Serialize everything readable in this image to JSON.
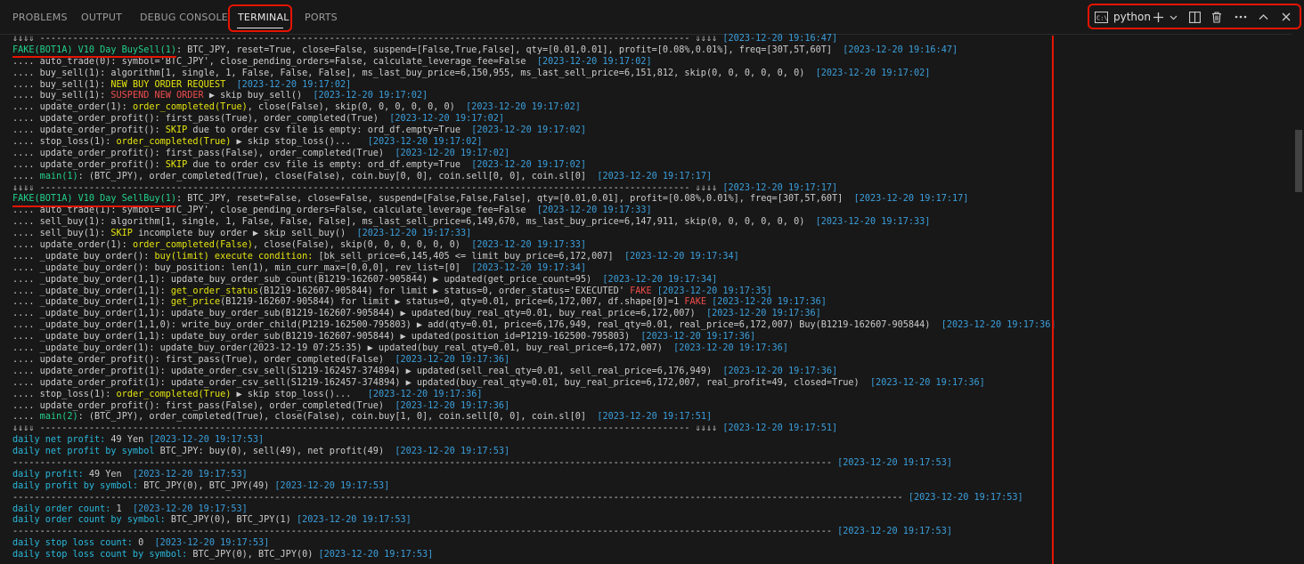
{
  "tabs": [
    {
      "label": "PROBLEMS"
    },
    {
      "label": "OUTPUT"
    },
    {
      "label": "DEBUG CONSOLE"
    },
    {
      "label": "TERMINAL"
    },
    {
      "label": "PORTS"
    }
  ],
  "toolbar": {
    "terminal_label": "python",
    "icons": [
      "terminal-icon",
      "plus-icon",
      "chevron-down-icon",
      "split-icon",
      "trash-icon",
      "more-icon",
      "chevron-up-icon",
      "close-icon"
    ]
  },
  "colors": {
    "annotation": "#e51400",
    "timestamp": "#3b9fdc",
    "yellow": "#e5e510",
    "red": "#f14c4c",
    "green": "#23d18b",
    "cyan": "#29b8db"
  },
  "lines": [
    [
      [
        "d",
        "⇓⇓⇓⇓ ----------------------------------------------------------------------------------------------------------------------- ⇓⇓⇓⇓ "
      ],
      [
        "ts",
        "[2023-12-20 19:16:47]"
      ]
    ],
    [
      [
        "g",
        "FAKE(BOT1A) V10 Day BuySell(1)"
      ],
      [
        "d",
        ": BTC_JPY, reset=True, close=False, suspend=[False,True,False], qty=[0.01,0.01], profit=[0.08%,0.01%], freq=[30T,5T,60T]  "
      ],
      [
        "ts",
        "[2023-12-20 19:16:47]"
      ]
    ],
    [
      [
        "d",
        ".... auto_trade(0): symbol='BTC_JPY', close_pending_orders=False, calculate_leverage_fee=False  "
      ],
      [
        "ts",
        "[2023-12-20 19:17:02]"
      ]
    ],
    [
      [
        "d",
        ".... buy_sell(1): algorithm[1, single, 1, False, False, False], ms_last_buy_price=6,150,955, ms_last_sell_price=6,151,812, skip(0, 0, 0, 0, 0, 0)  "
      ],
      [
        "ts",
        "[2023-12-20 19:17:02]"
      ]
    ],
    [
      [
        "d",
        ".... buy_sell(1): "
      ],
      [
        "y",
        "NEW BUY ORDER REQUEST"
      ],
      [
        "d",
        "  "
      ],
      [
        "ts",
        "[2023-12-20 19:17:02]"
      ]
    ],
    [
      [
        "d",
        ".... buy_sell(1): "
      ],
      [
        "r",
        "SUSPEND NEW ORDER"
      ],
      [
        "d",
        " ▶ skip buy_sell()  "
      ],
      [
        "ts",
        "[2023-12-20 19:17:02]"
      ]
    ],
    [
      [
        "d",
        ".... update_order(1): "
      ],
      [
        "y",
        "order_completed(True)"
      ],
      [
        "d",
        ", close(False), skip(0, 0, 0, 0, 0, 0)  "
      ],
      [
        "ts",
        "[2023-12-20 19:17:02]"
      ]
    ],
    [
      [
        "d",
        ".... update_order_profit(): first_pass(True), order_completed(True)  "
      ],
      [
        "ts",
        "[2023-12-20 19:17:02]"
      ]
    ],
    [
      [
        "d",
        ".... update_order_profit(): "
      ],
      [
        "y",
        "SKIP"
      ],
      [
        "d",
        " due to order csv file is empty: ord_df.empty=True  "
      ],
      [
        "ts",
        "[2023-12-20 19:17:02]"
      ]
    ],
    [
      [
        "d",
        ".... stop_loss(1): "
      ],
      [
        "y",
        "order_completed(True)"
      ],
      [
        "d",
        " ▶ skip stop_loss()...   "
      ],
      [
        "ts",
        "[2023-12-20 19:17:02]"
      ]
    ],
    [
      [
        "d",
        ".... update_order_profit(): first_pass(False), order_completed(True)  "
      ],
      [
        "ts",
        "[2023-12-20 19:17:02]"
      ]
    ],
    [
      [
        "d",
        ".... update_order_profit(): "
      ],
      [
        "y",
        "SKIP"
      ],
      [
        "d",
        " due to order csv file is empty: ord_df.empty=True  "
      ],
      [
        "ts",
        "[2023-12-20 19:17:02]"
      ]
    ],
    [
      [
        "d",
        "...."
      ],
      [
        "g",
        " main(1)"
      ],
      [
        "d",
        ": (BTC_JPY), order_completed(True), close(False), coin.buy[0, 0], coin.sell[0, 0], coin.sl[0]  "
      ],
      [
        "ts",
        "[2023-12-20 19:17:17]"
      ]
    ],
    [
      [
        "d",
        "⇓⇓⇓⇓ ----------------------------------------------------------------------------------------------------------------------- ⇓⇓⇓⇓ "
      ],
      [
        "ts",
        "[2023-12-20 19:17:17]"
      ]
    ],
    [
      [
        "g",
        "FAKE(BOT1A) V10 Day SellBuy(1)"
      ],
      [
        "d",
        ": BTC_JPY, reset=False, close=False, suspend=[False,False,False], qty=[0.01,0.01], profit=[0.08%,0.01%], freq=[30T,5T,60T]  "
      ],
      [
        "ts",
        "[2023-12-20 19:17:17]"
      ]
    ],
    [
      [
        "d",
        ".... auto_trade(1): symbol='BTC_JPY', close_pending_orders=False, calculate_leverage_fee=False  "
      ],
      [
        "ts",
        "[2023-12-20 19:17:33]"
      ]
    ],
    [
      [
        "d",
        ".... sell_buy(1): algorithm[1, single, 1, False, False, False], ms_last_sell_price=6,149,670, ms_last_buy_price=6,147,911, skip(0, 0, 0, 0, 0, 0)  "
      ],
      [
        "ts",
        "[2023-12-20 19:17:33]"
      ]
    ],
    [
      [
        "d",
        ".... sell_buy(1): "
      ],
      [
        "y",
        "SKIP"
      ],
      [
        "d",
        " incomplete buy order ▶ skip sell_buy()  "
      ],
      [
        "ts",
        "[2023-12-20 19:17:33]"
      ]
    ],
    [
      [
        "d",
        ".... update_order(1): "
      ],
      [
        "y",
        "order_completed(False)"
      ],
      [
        "d",
        ", close(False), skip(0, 0, 0, 0, 0, 0)  "
      ],
      [
        "ts",
        "[2023-12-20 19:17:33]"
      ]
    ],
    [
      [
        "d",
        ".... _update_buy_order(): "
      ],
      [
        "y",
        "buy(limit) execute condition:"
      ],
      [
        "d",
        " [bk_sell_price=6,145,405 <= limit_buy_price=6,172,007]  "
      ],
      [
        "ts",
        "[2023-12-20 19:17:34]"
      ]
    ],
    [
      [
        "d",
        ".... _update_buy_order(): buy_position: len(1), min_curr_max=[0,0,0], rev_list=[0]  "
      ],
      [
        "ts",
        "[2023-12-20 19:17:34]"
      ]
    ],
    [
      [
        "d",
        ".... _update_buy_order(1,1): update_buy_order_sub_count(B1219-162607-905844) ▶ updated(get_price_count=95)  "
      ],
      [
        "ts",
        "[2023-12-20 19:17:34]"
      ]
    ],
    [
      [
        "d",
        ".... _update_buy_order(1,1): "
      ],
      [
        "y",
        "get_order_status"
      ],
      [
        "d",
        "(B1219-162607-905844) for limit ▶ status=0, order_status='EXECUTED' "
      ],
      [
        "r",
        "FAKE"
      ],
      [
        "d",
        " "
      ],
      [
        "ts",
        "[2023-12-20 19:17:35]"
      ]
    ],
    [
      [
        "d",
        ".... _update_buy_order(1,1): "
      ],
      [
        "y",
        "get_price"
      ],
      [
        "d",
        "(B1219-162607-905844) for limit ▶ status=0, qty=0.01, price=6,172,007, df.shape[0]=1 "
      ],
      [
        "r",
        "FAKE"
      ],
      [
        "d",
        " "
      ],
      [
        "ts",
        "[2023-12-20 19:17:36]"
      ]
    ],
    [
      [
        "d",
        ".... _update_buy_order(1,1): update_buy_order_sub(B1219-162607-905844) ▶ updated(buy_real_qty=0.01, buy_real_price=6,172,007)  "
      ],
      [
        "ts",
        "[2023-12-20 19:17:36]"
      ]
    ],
    [
      [
        "d",
        ".... _update_buy_order(1,1,0): write_buy_order_child(P1219-162500-795803) ▶ add(qty=0.01, price=6,176,949, real_qty=0.01, real_price=6,172,007) Buy(B1219-162607-905844)  "
      ],
      [
        "ts",
        "[2023-12-20 19:17:36]"
      ]
    ],
    [
      [
        "d",
        ".... _update_buy_order(1,1): update_buy_order_sub(B1219-162607-905844) ▶ updated(position_id=P1219-162500-795803)  "
      ],
      [
        "ts",
        "[2023-12-20 19:17:36]"
      ]
    ],
    [
      [
        "d",
        ".... _update_buy_order(1): update_buy_order(2023-12-19 07:25:35) ▶ updated(buy_real_qty=0.01, buy_real_price=6,172,007)  "
      ],
      [
        "ts",
        "[2023-12-20 19:17:36]"
      ]
    ],
    [
      [
        "d",
        ".... update_order_profit(): first_pass(True), order_completed(False)  "
      ],
      [
        "ts",
        "[2023-12-20 19:17:36]"
      ]
    ],
    [
      [
        "d",
        ".... update_order_profit(1): update_order_csv_sell(S1219-162457-374894) ▶ updated(sell_real_qty=0.01, sell_real_price=6,176,949)  "
      ],
      [
        "ts",
        "[2023-12-20 19:17:36]"
      ]
    ],
    [
      [
        "d",
        ".... update_order_profit(1): update_order_csv_sell(S1219-162457-374894) ▶ updated(buy_real_qty=0.01, buy_real_price=6,172,007, real_profit=49, closed=True)  "
      ],
      [
        "ts",
        "[2023-12-20 19:17:36]"
      ]
    ],
    [
      [
        "d",
        ".... stop_loss(1): "
      ],
      [
        "y",
        "order_completed(True)"
      ],
      [
        "d",
        " ▶ skip stop_loss()...   "
      ],
      [
        "ts",
        "[2023-12-20 19:17:36]"
      ]
    ],
    [
      [
        "d",
        ".... update_order_profit(): first_pass(False), order_completed(True)  "
      ],
      [
        "ts",
        "[2023-12-20 19:17:36]"
      ]
    ],
    [
      [
        "d",
        "...."
      ],
      [
        "g",
        " main(2)"
      ],
      [
        "d",
        ": (BTC_JPY), order_completed(True), close(False), coin.buy[1, 0], coin.sell[0, 0], coin.sl[0]  "
      ],
      [
        "ts",
        "[2023-12-20 19:17:51]"
      ]
    ],
    [
      [
        "d",
        "⇓⇓⇓⇓ ----------------------------------------------------------------------------------------------------------------------- ⇓⇓⇓⇓ "
      ],
      [
        "ts",
        "[2023-12-20 19:17:51]"
      ]
    ],
    [
      [
        "c",
        "daily net profit:"
      ],
      [
        "d",
        " 49 Yen "
      ],
      [
        "ts",
        "[2023-12-20 19:17:53]"
      ]
    ],
    [
      [
        "c",
        "daily net profit by symbol"
      ],
      [
        "d",
        " BTC_JPY: buy(0), sell(49), net profit(49)  "
      ],
      [
        "ts",
        "[2023-12-20 19:17:53]"
      ]
    ],
    [
      [
        "d",
        "------------------------------------------------------------------------------------------------------------------------------------------------------ "
      ],
      [
        "ts",
        "[2023-12-20 19:17:53]"
      ]
    ],
    [
      [
        "c",
        "daily profit:"
      ],
      [
        "d",
        " 49 Yen  "
      ],
      [
        "ts",
        "[2023-12-20 19:17:53]"
      ]
    ],
    [
      [
        "c",
        "daily profit by symbol:"
      ],
      [
        "d",
        " BTC_JPY(0), BTC_JPY(49) "
      ],
      [
        "ts",
        "[2023-12-20 19:17:53]"
      ]
    ],
    [
      [
        "d",
        "------------------------------------------------------------------------------------------------------------------------------------------------------------------- "
      ],
      [
        "ts",
        "[2023-12-20 19:17:53]"
      ]
    ],
    [
      [
        "c",
        "daily order count:"
      ],
      [
        "d",
        " 1  "
      ],
      [
        "ts",
        "[2023-12-20 19:17:53]"
      ]
    ],
    [
      [
        "c",
        "daily order count by symbol:"
      ],
      [
        "d",
        " BTC_JPY(0), BTC_JPY(1) "
      ],
      [
        "ts",
        "[2023-12-20 19:17:53]"
      ]
    ],
    [
      [
        "d",
        "------------------------------------------------------------------------------------------------------------------------------------------------------ "
      ],
      [
        "ts",
        "[2023-12-20 19:17:53]"
      ]
    ],
    [
      [
        "c",
        "daily stop loss count:"
      ],
      [
        "d",
        " 0  "
      ],
      [
        "ts",
        "[2023-12-20 19:17:53]"
      ]
    ],
    [
      [
        "c",
        "daily stop loss count by symbol:"
      ],
      [
        "d",
        " BTC_JPY(0), BTC_JPY(0) "
      ],
      [
        "ts",
        "[2023-12-20 19:17:53]"
      ]
    ]
  ]
}
